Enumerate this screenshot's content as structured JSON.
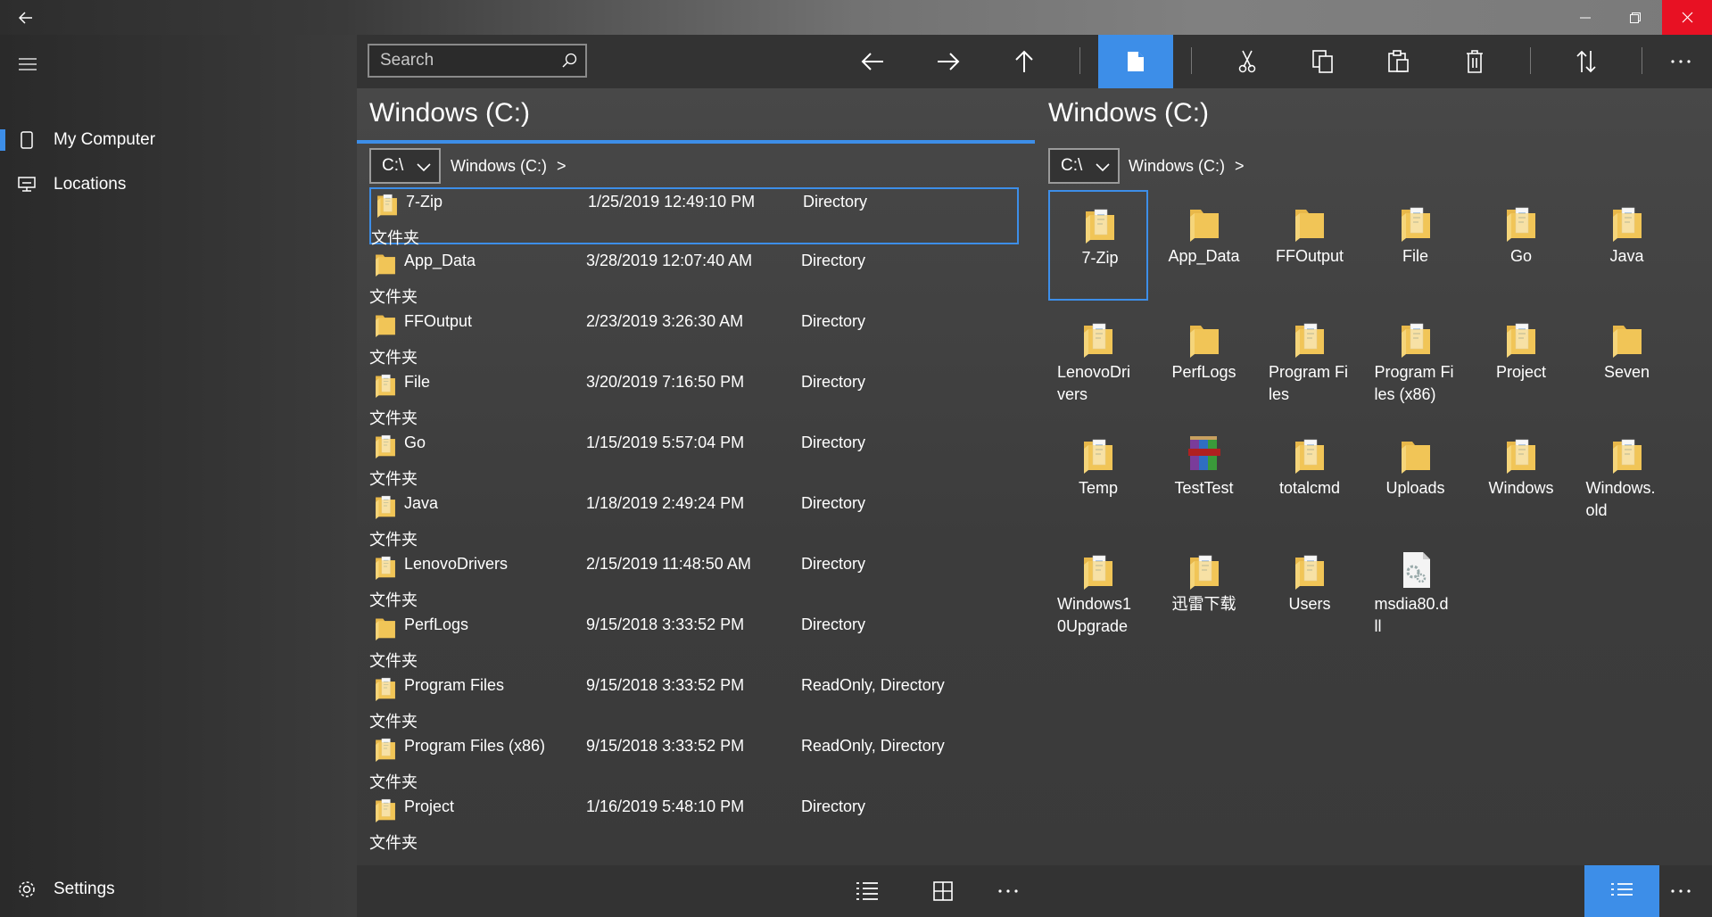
{
  "window": {
    "controls": [
      "minimize-icon",
      "restore-icon",
      "close-icon"
    ]
  },
  "sidebar": {
    "items": [
      {
        "label": "My Computer",
        "icon": "tablet-icon",
        "active": true
      },
      {
        "label": "Locations",
        "icon": "monitor-icon",
        "active": false
      }
    ],
    "settings_label": "Settings"
  },
  "toolbar": {
    "search_placeholder": "Search",
    "buttons": [
      "back-arrow-icon",
      "forward-arrow-icon",
      "up-arrow-icon",
      "new-file-icon",
      "cut-icon",
      "copy-icon",
      "paste-icon",
      "delete-icon",
      "sort-icon",
      "more-icon"
    ],
    "accent": "#3d8ee8"
  },
  "left_pane": {
    "title": "Windows (C:)",
    "drive": "C:\\",
    "breadcrumb": "Windows (C:)",
    "crumb_sep": ">",
    "rows": [
      {
        "name": "7-Zip",
        "date": "1/25/2019 12:49:10 PM",
        "attr": "Directory",
        "type": "文件夹",
        "icon": "folder-doc"
      },
      {
        "name": "App_Data",
        "date": "3/28/2019 12:07:40 AM",
        "attr": "Directory",
        "type": "文件夹",
        "icon": "folder"
      },
      {
        "name": "FFOutput",
        "date": "2/23/2019 3:26:30 AM",
        "attr": "Directory",
        "type": "文件夹",
        "icon": "folder"
      },
      {
        "name": "File",
        "date": "3/20/2019 7:16:50 PM",
        "attr": "Directory",
        "type": "文件夹",
        "icon": "folder-doc"
      },
      {
        "name": "Go",
        "date": "1/15/2019 5:57:04 PM",
        "attr": "Directory",
        "type": "文件夹",
        "icon": "folder-doc"
      },
      {
        "name": "Java",
        "date": "1/18/2019 2:49:24 PM",
        "attr": "Directory",
        "type": "文件夹",
        "icon": "folder-doc"
      },
      {
        "name": "LenovoDrivers",
        "date": "2/15/2019 11:48:50 AM",
        "attr": "Directory",
        "type": "文件夹",
        "icon": "folder-doc"
      },
      {
        "name": "PerfLogs",
        "date": "9/15/2018 3:33:52 PM",
        "attr": "Directory",
        "type": "文件夹",
        "icon": "folder"
      },
      {
        "name": "Program Files",
        "date": "9/15/2018 3:33:52 PM",
        "attr": "ReadOnly, Directory",
        "type": "文件夹",
        "icon": "folder-doc"
      },
      {
        "name": "Program Files (x86)",
        "date": "9/15/2018 3:33:52 PM",
        "attr": "ReadOnly, Directory",
        "type": "文件夹",
        "icon": "folder-doc"
      },
      {
        "name": "Project",
        "date": "1/16/2019 5:48:10 PM",
        "attr": "Directory",
        "type": "文件夹",
        "icon": "folder-doc"
      }
    ]
  },
  "right_pane": {
    "title": "Windows (C:)",
    "drive": "C:\\",
    "breadcrumb": "Windows (C:)",
    "crumb_sep": ">",
    "tiles": [
      {
        "name": "7-Zip",
        "icon": "folder-doc"
      },
      {
        "name": "App_Data",
        "icon": "folder"
      },
      {
        "name": "FFOutput",
        "icon": "folder"
      },
      {
        "name": "File",
        "icon": "folder-doc"
      },
      {
        "name": "Go",
        "icon": "folder-doc"
      },
      {
        "name": "Java",
        "icon": "folder-doc"
      },
      {
        "name": "LenovoDri vers",
        "icon": "folder-doc"
      },
      {
        "name": "PerfLogs",
        "icon": "folder"
      },
      {
        "name": "Program Files",
        "icon": "folder-doc"
      },
      {
        "name": "Program Files (x86)",
        "icon": "folder-doc"
      },
      {
        "name": "Project",
        "icon": "folder-doc"
      },
      {
        "name": "Seven",
        "icon": "folder"
      },
      {
        "name": "Temp",
        "icon": "folder-doc"
      },
      {
        "name": "TestTest",
        "icon": "winrar"
      },
      {
        "name": "totalcmd",
        "icon": "folder-doc"
      },
      {
        "name": "Uploads",
        "icon": "folder"
      },
      {
        "name": "Windows",
        "icon": "folder-doc"
      },
      {
        "name": "Windows. old",
        "icon": "folder-doc"
      },
      {
        "name": "Windows1 0Upgrade",
        "icon": "folder-doc"
      },
      {
        "name": "迅雷下载",
        "icon": "folder-doc"
      },
      {
        "name": "Users",
        "icon": "folder-doc"
      },
      {
        "name": "msdia80.d ll",
        "icon": "dll"
      }
    ]
  },
  "bottombar": {
    "buttons": [
      "list-view-icon",
      "grid-view-icon",
      "more-icon"
    ],
    "right_buttons": [
      "details-view-icon",
      "more-icon"
    ]
  }
}
